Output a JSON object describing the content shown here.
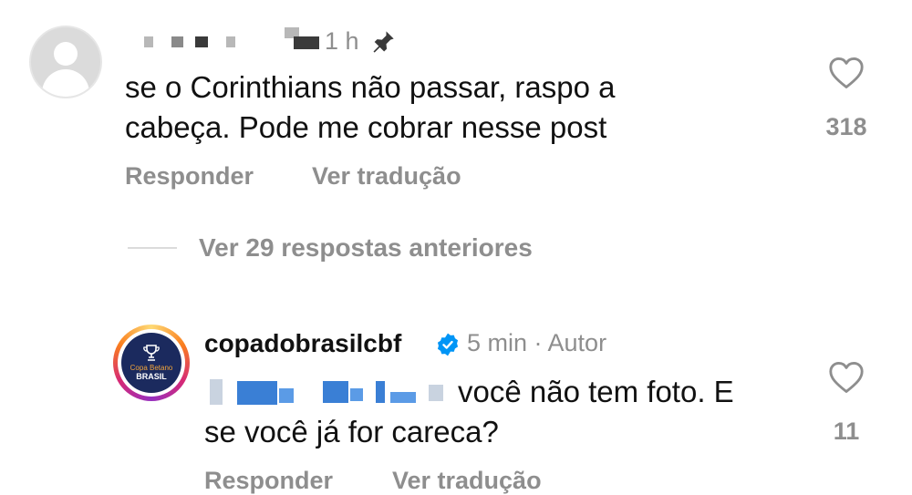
{
  "comment1": {
    "avatar_icon": "default-avatar-icon",
    "timestamp": "1 h",
    "pin_icon": "pin-icon",
    "text_line1": "se o Corinthians não passar, raspo a",
    "text_line2": "cabeça. Pode me cobrar nesse post",
    "like_icon": "heart-icon",
    "like_count": "318",
    "reply_label": "Responder",
    "translate_label": "Ver tradução"
  },
  "replies": {
    "label": "Ver 29 respostas anteriores"
  },
  "comment2": {
    "username": "copadobrasilcbf",
    "verified_icon": "verified-badge-icon",
    "meta": "5 min · Autor",
    "avatar_logo_line1": "Copa Betano",
    "avatar_logo_line2": "BRASIL",
    "text_line1": "você não tem foto. E",
    "text_line2": "se você já for careca?",
    "like_icon": "heart-icon",
    "like_count": "11",
    "reply_label": "Responder",
    "translate_label": "Ver tradução"
  },
  "colors": {
    "text": "#111111",
    "secondary": "#8e8e8e",
    "verified": "#0095f6",
    "logo_bg": "#1b2a5e"
  }
}
